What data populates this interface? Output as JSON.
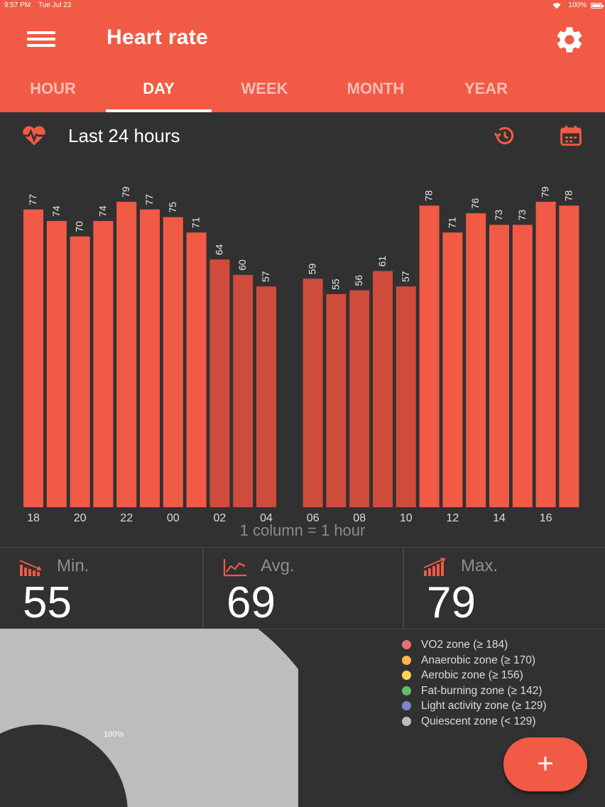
{
  "status_bar": {
    "time": "9:57 PM",
    "date": "Tue Jul 23",
    "battery": "100%"
  },
  "app_bar": {
    "title": "Heart rate",
    "menu_icon": "hamburger-menu-icon",
    "settings_icon": "gear-icon"
  },
  "tabs": [
    {
      "label": "HOUR",
      "active": false
    },
    {
      "label": "DAY",
      "active": true
    },
    {
      "label": "WEEK",
      "active": false
    },
    {
      "label": "MONTH",
      "active": false
    },
    {
      "label": "YEAR",
      "active": false
    }
  ],
  "section": {
    "title": "Last 24 hours",
    "heart_icon": "heart-pulse-icon",
    "history_icon": "history-icon",
    "calendar_icon": "calendar-icon"
  },
  "chart_data": {
    "type": "bar",
    "values": [
      77,
      74,
      70,
      74,
      79,
      77,
      75,
      71,
      64,
      60,
      57,
      null,
      59,
      55,
      56,
      61,
      57,
      78,
      71,
      76,
      73,
      73,
      79,
      78
    ],
    "highlighted_range": [
      8,
      16
    ],
    "tick_labels": [
      "18",
      "20",
      "22",
      "00",
      "02",
      "04",
      "06",
      "08",
      "10",
      "12",
      "14",
      "16"
    ],
    "caption": "1 column = 1 hour",
    "colors": {
      "bar": "#f15a45",
      "bar_dim": "#cf4b3b",
      "label": "#e8e8e8"
    }
  },
  "stats": [
    {
      "label": "Min.",
      "value": "55",
      "icon": "bars-descending-icon"
    },
    {
      "label": "Avg.",
      "value": "69",
      "icon": "line-chart-icon"
    },
    {
      "label": "Max.",
      "value": "79",
      "icon": "bars-ascending-icon"
    }
  ],
  "zones": {
    "donut_label": "100%",
    "legend": [
      {
        "label": "VO2 zone (≥ 184)",
        "color": "#e57373"
      },
      {
        "label": "Anaerobic zone (≥ 170)",
        "color": "#ffb74d"
      },
      {
        "label": "Aerobic zone (≥ 156)",
        "color": "#ffd54f"
      },
      {
        "label": "Fat-burning zone (≥ 142)",
        "color": "#66bb6a"
      },
      {
        "label": "Light activity zone (≥ 129)",
        "color": "#7986cb"
      },
      {
        "label": "Quiescent zone (< 129)",
        "color": "#bdbdbd"
      }
    ]
  },
  "fab": {
    "label": "+"
  }
}
